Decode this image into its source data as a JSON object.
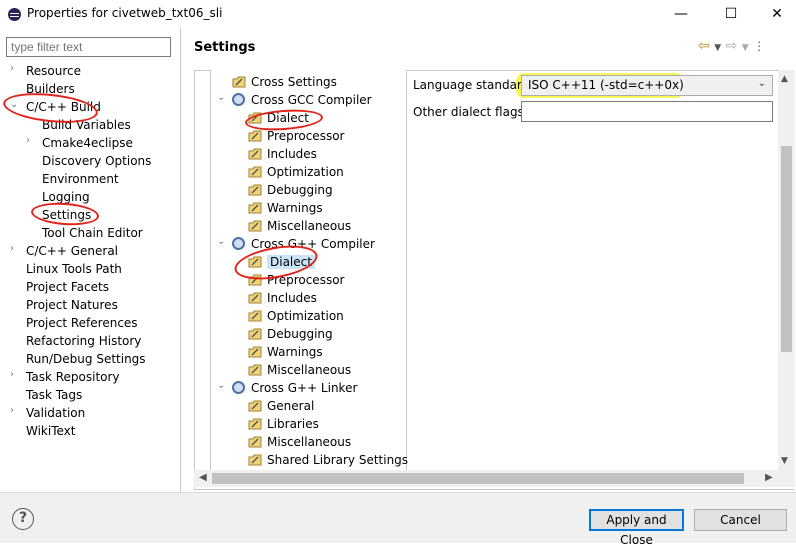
{
  "window": {
    "title": "Properties for civetweb_txt06_sli"
  },
  "left_nav": {
    "filter_placeholder": "type filter text",
    "items": [
      {
        "label": "Resource",
        "twisty": "›"
      },
      {
        "label": "Builders",
        "twisty": ""
      },
      {
        "label": "C/C++ Build",
        "twisty": "⌄"
      },
      {
        "label": "Build Variables",
        "twisty": ""
      },
      {
        "label": "Cmake4eclipse",
        "twisty": "›"
      },
      {
        "label": "Discovery Options",
        "twisty": ""
      },
      {
        "label": "Environment",
        "twisty": ""
      },
      {
        "label": "Logging",
        "twisty": ""
      },
      {
        "label": "Settings",
        "twisty": ""
      },
      {
        "label": "Tool Chain Editor",
        "twisty": ""
      },
      {
        "label": "C/C++ General",
        "twisty": "›"
      },
      {
        "label": "Linux Tools Path",
        "twisty": ""
      },
      {
        "label": "Project Facets",
        "twisty": ""
      },
      {
        "label": "Project Natures",
        "twisty": ""
      },
      {
        "label": "Project References",
        "twisty": ""
      },
      {
        "label": "Refactoring History",
        "twisty": ""
      },
      {
        "label": "Run/Debug Settings",
        "twisty": ""
      },
      {
        "label": "Task Repository",
        "twisty": "›"
      },
      {
        "label": "Task Tags",
        "twisty": ""
      },
      {
        "label": "Validation",
        "twisty": "›"
      },
      {
        "label": "WikiText",
        "twisty": ""
      }
    ]
  },
  "header": {
    "title": "Settings"
  },
  "tool_tree": {
    "items": [
      {
        "label": "Cross Settings",
        "kind": "tool"
      },
      {
        "label": "Cross GCC Compiler",
        "kind": "gear"
      },
      {
        "label": "Dialect",
        "kind": "tool"
      },
      {
        "label": "Preprocessor",
        "kind": "tool"
      },
      {
        "label": "Includes",
        "kind": "tool"
      },
      {
        "label": "Optimization",
        "kind": "tool"
      },
      {
        "label": "Debugging",
        "kind": "tool"
      },
      {
        "label": "Warnings",
        "kind": "tool"
      },
      {
        "label": "Miscellaneous",
        "kind": "tool"
      },
      {
        "label": "Cross G++ Compiler",
        "kind": "gear"
      },
      {
        "label": "Dialect",
        "kind": "tool"
      },
      {
        "label": "Preprocessor",
        "kind": "tool"
      },
      {
        "label": "Includes",
        "kind": "tool"
      },
      {
        "label": "Optimization",
        "kind": "tool"
      },
      {
        "label": "Debugging",
        "kind": "tool"
      },
      {
        "label": "Warnings",
        "kind": "tool"
      },
      {
        "label": "Miscellaneous",
        "kind": "tool"
      },
      {
        "label": "Cross G++ Linker",
        "kind": "gear"
      },
      {
        "label": "General",
        "kind": "tool"
      },
      {
        "label": "Libraries",
        "kind": "tool"
      },
      {
        "label": "Miscellaneous",
        "kind": "tool"
      },
      {
        "label": "Shared Library Settings",
        "kind": "tool"
      }
    ],
    "selected_index": 10
  },
  "options": {
    "language_standard_label": "Language standard",
    "language_standard_value": "ISO C++11 (-std=c++0x)",
    "other_flags_label": "Other dialect flags",
    "other_flags_value": ""
  },
  "footer": {
    "help_label": "?",
    "apply_close_label": "Apply and Close",
    "cancel_label": "Cancel"
  },
  "colors": {
    "highlight": "#f4f43a",
    "annotation": "#e2231a",
    "selection": "#cce4f7"
  }
}
